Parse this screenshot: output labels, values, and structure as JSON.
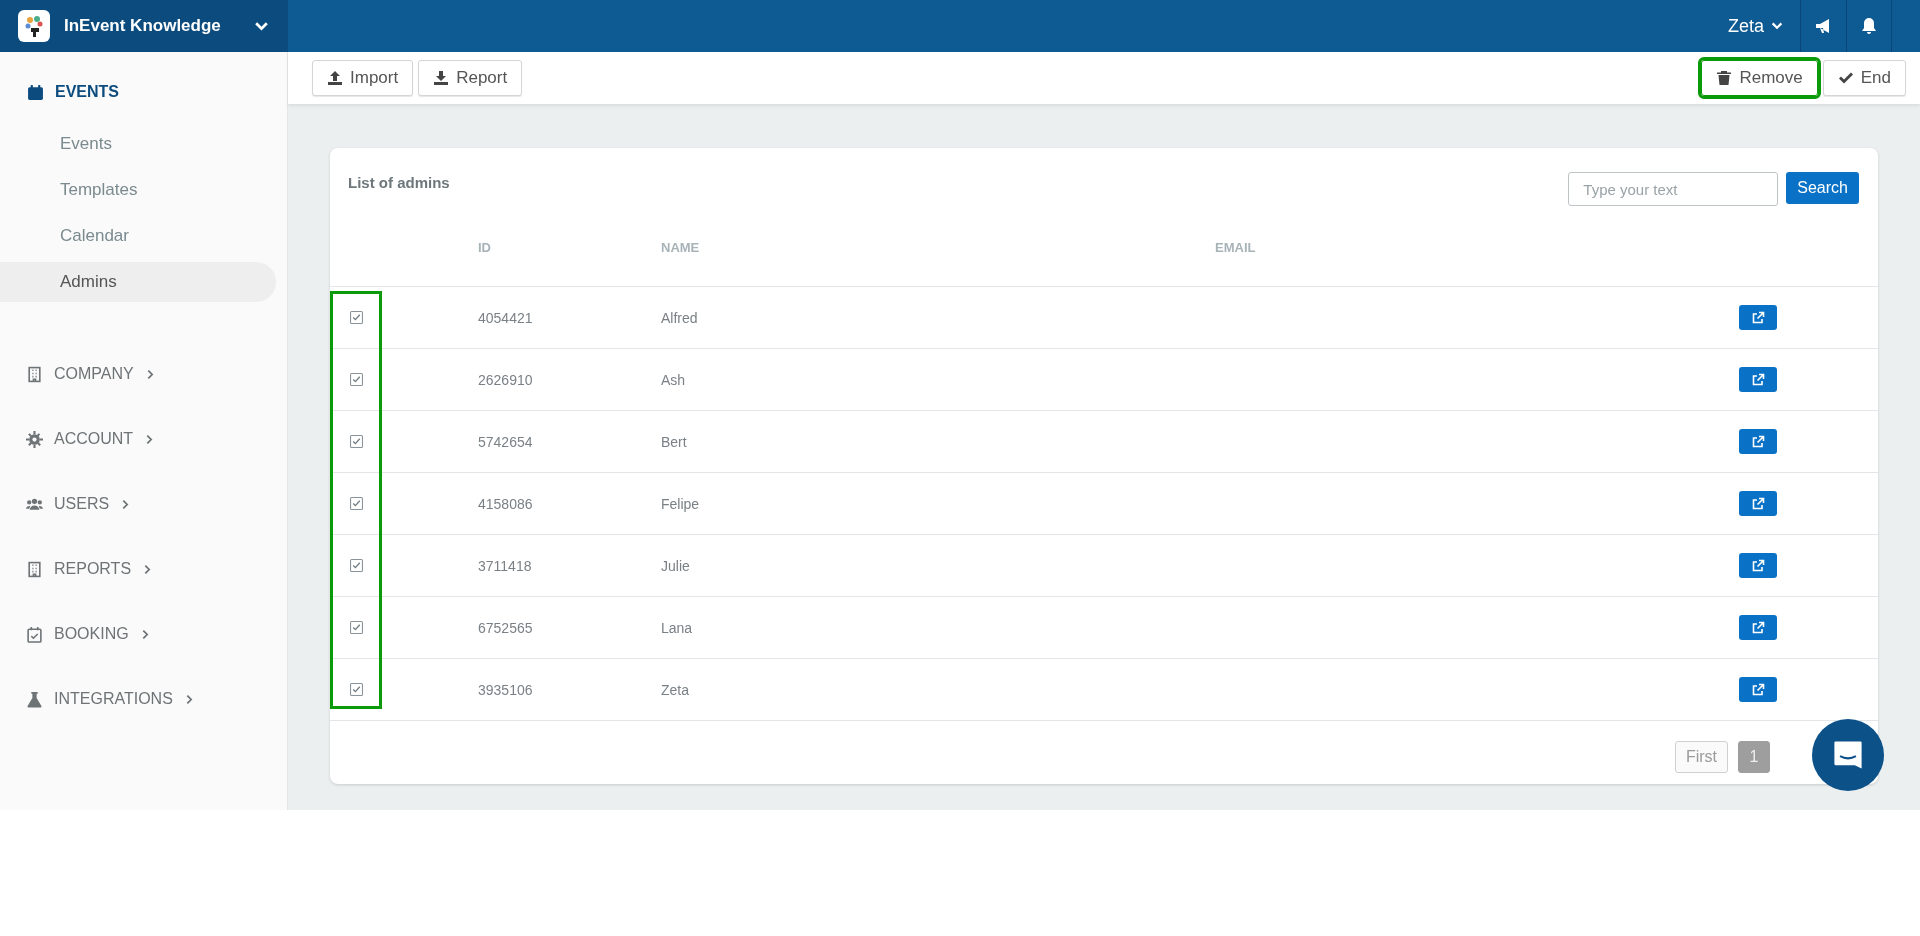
{
  "topbar": {
    "app_name": "InEvent Knowledge",
    "user": "Zeta"
  },
  "sidebar": {
    "sections": [
      {
        "label": "EVENTS",
        "expanded": true,
        "items": [
          {
            "label": "Events",
            "selected": false
          },
          {
            "label": "Templates",
            "selected": false
          },
          {
            "label": "Calendar",
            "selected": false
          },
          {
            "label": "Admins",
            "selected": true
          }
        ]
      },
      {
        "label": "COMPANY",
        "expanded": false
      },
      {
        "label": "ACCOUNT",
        "expanded": false
      },
      {
        "label": "USERS",
        "expanded": false
      },
      {
        "label": "REPORTS",
        "expanded": false
      },
      {
        "label": "BOOKING",
        "expanded": false
      },
      {
        "label": "INTEGRATIONS",
        "expanded": false
      }
    ]
  },
  "toolbar": {
    "left": [
      {
        "label": "Import",
        "highlighted": false
      },
      {
        "label": "Report",
        "highlighted": false
      }
    ],
    "right": [
      {
        "label": "Remove",
        "highlighted": true
      },
      {
        "label": "End",
        "highlighted": false
      }
    ]
  },
  "card": {
    "title": "List of admins",
    "search": {
      "placeholder": "Type your text",
      "button": "Search"
    },
    "table": {
      "checkbox_column_highlighted": true,
      "columns": [
        "ID",
        "NAME",
        "EMAIL"
      ],
      "rows": [
        {
          "checked": true,
          "id": "4054421",
          "name": "Alfred"
        },
        {
          "checked": true,
          "id": "2626910",
          "name": "Ash"
        },
        {
          "checked": true,
          "id": "5742654",
          "name": "Bert"
        },
        {
          "checked": true,
          "id": "4158086",
          "name": "Felipe"
        },
        {
          "checked": true,
          "id": "3711418",
          "name": "Julie"
        },
        {
          "checked": true,
          "id": "6752565",
          "name": "Lana"
        },
        {
          "checked": true,
          "id": "3935106",
          "name": "Zeta"
        }
      ]
    },
    "pagination": [
      {
        "label": "First",
        "selected": false
      },
      {
        "label": "1",
        "selected": true
      }
    ]
  }
}
